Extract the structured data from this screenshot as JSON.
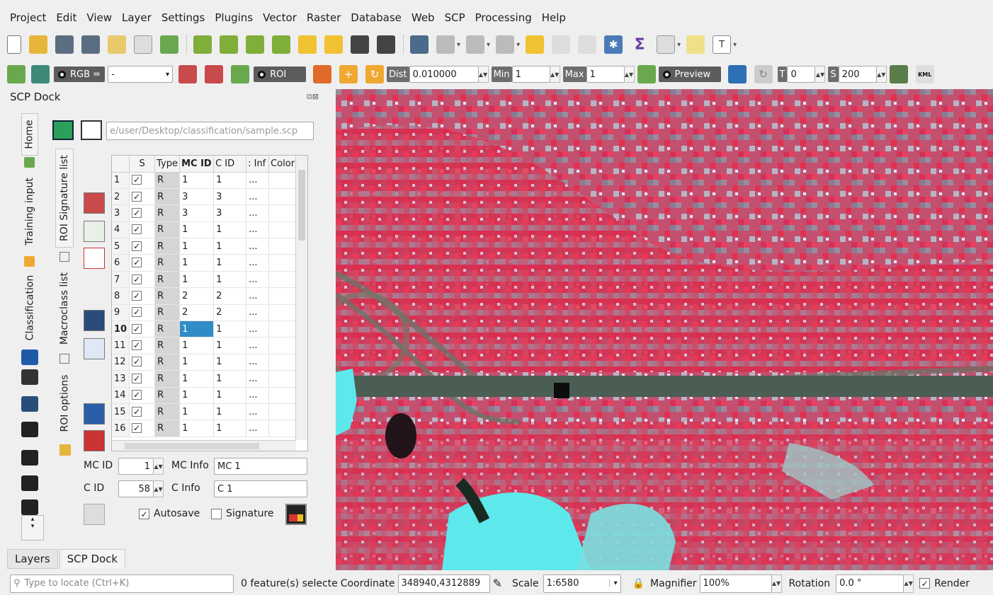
{
  "menu": [
    "Project",
    "Edit",
    "View",
    "Layer",
    "Settings",
    "Plugins",
    "Vector",
    "Raster",
    "Database",
    "Web",
    "SCP",
    "Processing",
    "Help"
  ],
  "scp_toolbar": {
    "rgb_label": "RGB =",
    "rgb_value": "-",
    "roi_label": "ROI",
    "dist_label": "Dist",
    "dist_value": "0.010000",
    "min_label": "Min",
    "min_value": "1",
    "max_label": "Max",
    "max_value": "1",
    "preview_label": "Preview",
    "t_label": "T",
    "t_value": "0",
    "s_label": "S",
    "s_value": "200",
    "kml_label": "KML"
  },
  "dock": {
    "title": "SCP Dock",
    "side_tabs": [
      "Home",
      "Training input",
      "Classification"
    ],
    "sub_tabs": [
      "ROI Signature list",
      "Macroclass list",
      "ROI options"
    ],
    "file_path": "e/user/Desktop/classification/sample.scp"
  },
  "table": {
    "columns": [
      "S",
      "Type",
      "MC ID",
      "C ID",
      ": Inf",
      "Color"
    ],
    "rows": [
      {
        "n": "1",
        "s": "✓",
        "type": "R",
        "mc": "1",
        "c": "1",
        "inf": "..."
      },
      {
        "n": "2",
        "s": "✓",
        "type": "R",
        "mc": "3",
        "c": "3",
        "inf": "..."
      },
      {
        "n": "3",
        "s": "✓",
        "type": "R",
        "mc": "3",
        "c": "3",
        "inf": "..."
      },
      {
        "n": "4",
        "s": "✓",
        "type": "R",
        "mc": "1",
        "c": "1",
        "inf": "..."
      },
      {
        "n": "5",
        "s": "✓",
        "type": "R",
        "mc": "1",
        "c": "1",
        "inf": "..."
      },
      {
        "n": "6",
        "s": "✓",
        "type": "R",
        "mc": "1",
        "c": "1",
        "inf": "..."
      },
      {
        "n": "7",
        "s": "✓",
        "type": "R",
        "mc": "1",
        "c": "1",
        "inf": "..."
      },
      {
        "n": "8",
        "s": "✓",
        "type": "R",
        "mc": "2",
        "c": "2",
        "inf": "..."
      },
      {
        "n": "9",
        "s": "✓",
        "type": "R",
        "mc": "2",
        "c": "2",
        "inf": "..."
      },
      {
        "n": "10",
        "s": "✓",
        "type": "R",
        "mc": "1",
        "c": "1",
        "inf": "..."
      },
      {
        "n": "11",
        "s": "✓",
        "type": "R",
        "mc": "1",
        "c": "1",
        "inf": "..."
      },
      {
        "n": "12",
        "s": "✓",
        "type": "R",
        "mc": "1",
        "c": "1",
        "inf": "..."
      },
      {
        "n": "13",
        "s": "✓",
        "type": "R",
        "mc": "1",
        "c": "1",
        "inf": "..."
      },
      {
        "n": "14",
        "s": "✓",
        "type": "R",
        "mc": "1",
        "c": "1",
        "inf": "..."
      },
      {
        "n": "15",
        "s": "✓",
        "type": "R",
        "mc": "1",
        "c": "1",
        "inf": "..."
      },
      {
        "n": "16",
        "s": "✓",
        "type": "R",
        "mc": "1",
        "c": "1",
        "inf": "..."
      }
    ],
    "selected_row": 10
  },
  "form": {
    "mc_id_label": "MC ID",
    "mc_id_value": "1",
    "mc_info_label": "MC Info",
    "mc_info_value": "MC 1",
    "c_id_label": "C ID",
    "c_id_value": "58",
    "c_info_label": "C Info",
    "c_info_value": "C 1",
    "autosave_label": "Autosave",
    "signature_label": "Signature"
  },
  "bottom_tabs": [
    "Layers",
    "SCP Dock"
  ],
  "status": {
    "locate_placeholder": "Type to locate (Ctrl+K)",
    "selection_text": "0 feature(s) selecte",
    "coordinate_label": "Coordinate",
    "coordinate_value": "348940,4312889",
    "scale_label": "Scale",
    "scale_value": "1:6580",
    "magnifier_label": "Magnifier",
    "magnifier_value": "100%",
    "rotation_label": "Rotation",
    "rotation_value": "0.0 °",
    "render_label": "Render"
  },
  "colors": {
    "map_red": "#d82a4c",
    "road_gray": "#4a5e54",
    "cyan": "#5de8ec",
    "selection_blue": "#308cc6"
  }
}
